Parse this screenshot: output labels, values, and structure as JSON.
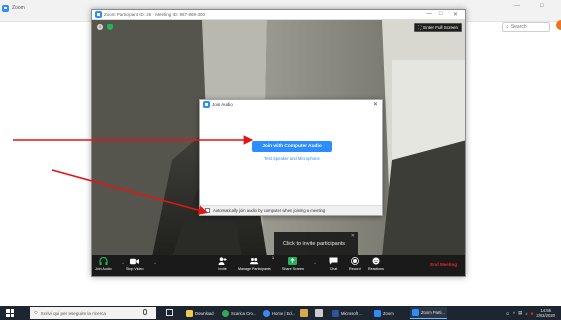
{
  "background_app": {
    "title": "Zoom",
    "search_placeholder": "Search",
    "window_controls": {
      "minimize": "—",
      "maximize": "□"
    }
  },
  "meeting_window": {
    "title": "Zoom Participant ID: 26 · Meeting ID: 987-869-300",
    "window_controls": {
      "minimize": "—",
      "maximize": "□",
      "close": "✕"
    },
    "enter_full_screen": "Enter Full Screen"
  },
  "join_audio_dialog": {
    "title": "Join Audio",
    "close": "✕",
    "join_button": "Join with Computer Audio",
    "test_link": "Test Speaker and Microphone",
    "auto_join_label": "Automatically join audio by computer when joining a meeting",
    "auto_join_checked": false
  },
  "participants_overlay": {
    "text": "Click to invite participants",
    "close": "✕"
  },
  "toolbar": {
    "join_audio": "Join Audio",
    "stop_video": "Stop Video",
    "invite": "Invite",
    "manage_participants": "Manage Participants",
    "participant_count": "1",
    "share_screen": "Share Screen",
    "chat": "Chat",
    "record": "Record",
    "reactions": "Reactions",
    "end_meeting": "End Meeting",
    "caret": "^",
    "colors": {
      "share": "#21b25a",
      "end": "#e02828"
    }
  },
  "taskbar": {
    "search_placeholder": "Scrivi qui per eseguire la ricerca",
    "apps": [
      {
        "label": "Download",
        "icon": "folder-icon",
        "color": "#f2c94c"
      },
      {
        "label": "Scarica Cro...",
        "icon": "chrome-icon",
        "color": "#34a853"
      },
      {
        "label": "Home | Ed...",
        "icon": "chrome-icon",
        "color": "#4285f4"
      },
      {
        "label": "Microsoft ...",
        "icon": "word-icon",
        "color": "#2b579a"
      },
      {
        "label": "Zoom",
        "icon": "zoom-icon",
        "color": "#2d8cff"
      },
      {
        "label": "Zoom Parti...",
        "icon": "zoom-icon",
        "color": "#2d8cff"
      }
    ],
    "time": "14:55",
    "date": "2/03/2020"
  }
}
